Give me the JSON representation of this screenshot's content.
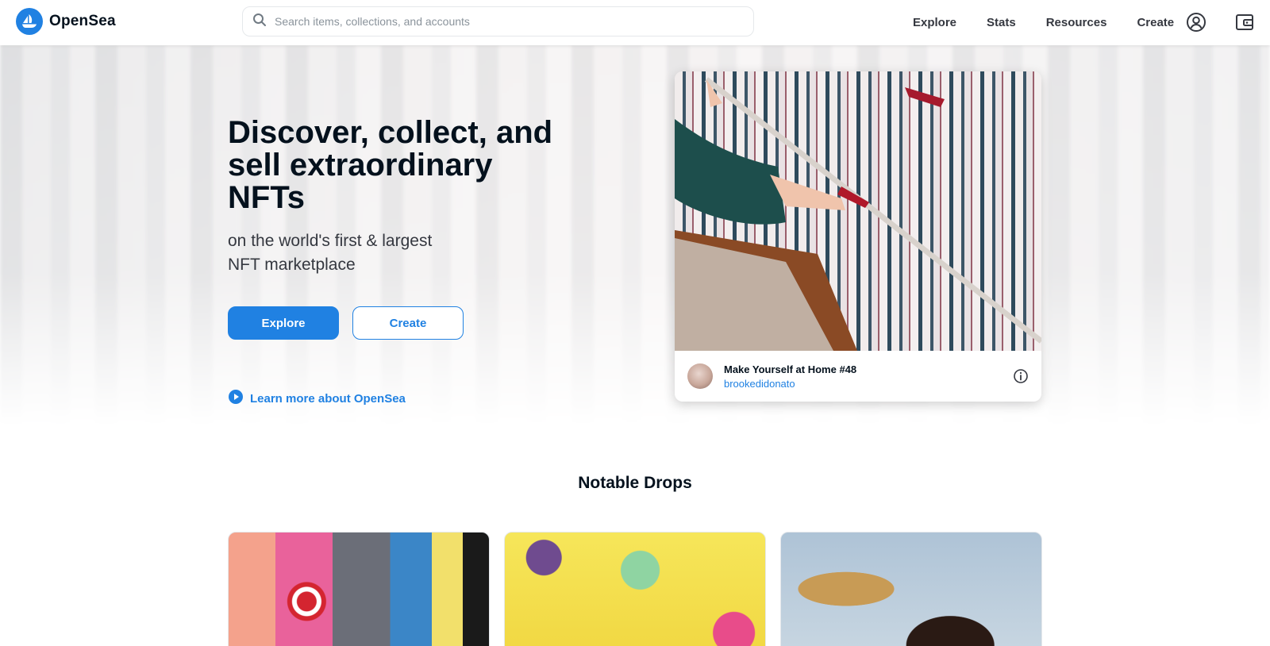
{
  "brand": {
    "name": "OpenSea",
    "accent": "#2081e2"
  },
  "header": {
    "search_placeholder": "Search items, collections, and accounts",
    "nav": [
      "Explore",
      "Stats",
      "Resources",
      "Create"
    ],
    "icons": [
      "account-icon",
      "wallet-icon"
    ]
  },
  "hero": {
    "title": "Discover, collect, and sell extraordinary NFTs",
    "subtitle": "on the world's first & largest NFT marketplace",
    "explore_label": "Explore",
    "create_label": "Create",
    "learn_more": "Learn more about OpenSea",
    "featured": {
      "title": "Make Yourself at Home #48",
      "creator": "brookedidonato"
    }
  },
  "notable": {
    "title": "Notable Drops"
  }
}
